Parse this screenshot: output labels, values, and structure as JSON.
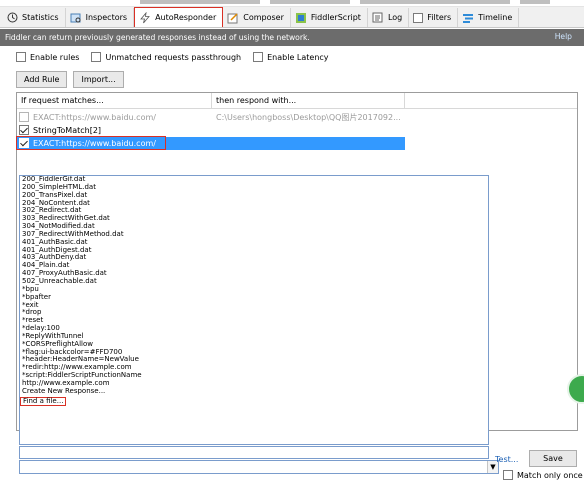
{
  "tabs": [
    {
      "label": "Statistics",
      "icon": "clock-icon"
    },
    {
      "label": "Inspectors",
      "icon": "inspector-icon"
    },
    {
      "label": "AutoResponder",
      "icon": "lightning-icon"
    },
    {
      "label": "Composer",
      "icon": "composer-icon"
    },
    {
      "label": "FiddlerScript",
      "icon": "script-icon"
    },
    {
      "label": "Log",
      "icon": "log-icon"
    },
    {
      "label": "Filters",
      "icon": "filter-checkbox-icon"
    },
    {
      "label": "Timeline",
      "icon": "timeline-icon"
    }
  ],
  "info": {
    "text": "Fiddler can return previously generated responses instead of using the network.",
    "help": "Help"
  },
  "options": {
    "enable_rules": "Enable rules",
    "unmatched": "Unmatched requests passthrough",
    "latency": "Enable Latency"
  },
  "buttons": {
    "add_rule": "Add Rule",
    "import": "Import..."
  },
  "list": {
    "col1": "If request matches...",
    "col2": "then respond with...",
    "rows": [
      {
        "match": "EXACT:https://www.baidu.com/",
        "respond": "C:\\Users\\hongboss\\Desktop\\QQ图片2017092..."
      },
      {
        "match": "StringToMatch[2]",
        "respond": ""
      },
      {
        "match": "EXACT:https://www.baidu.com/",
        "respond": ""
      }
    ]
  },
  "dropdown_items": [
    "200_FiddlerGif.dat",
    "200_SimpleHTML.dat",
    "200_TransPixel.dat",
    "204_NoContent.dat",
    "302_Redirect.dat",
    "303_RedirectWithGet.dat",
    "304_NotModified.dat",
    "307_RedirectWithMethod.dat",
    "401_AuthBasic.dat",
    "401_AuthDigest.dat",
    "403_AuthDeny.dat",
    "404_Plain.dat",
    "407_ProxyAuthBasic.dat",
    "502_Unreachable.dat",
    "*bpu",
    "*bpafter",
    "*exit",
    "*drop",
    "*reset",
    "*delay:100",
    "*ReplyWithTunnel",
    "*CORSPreflightAllow",
    "*flag:ui-backcolor=#FFD700",
    "*header:HeaderName=NewValue",
    "*redir:http://www.example.com",
    "*script:FiddlerScriptFunctionName",
    "http://www.example.com",
    "Create New Response..."
  ],
  "find_file": "Find a file...",
  "bottom": {
    "test": "Test...",
    "save": "Save",
    "match_only_once": "Match only once"
  }
}
